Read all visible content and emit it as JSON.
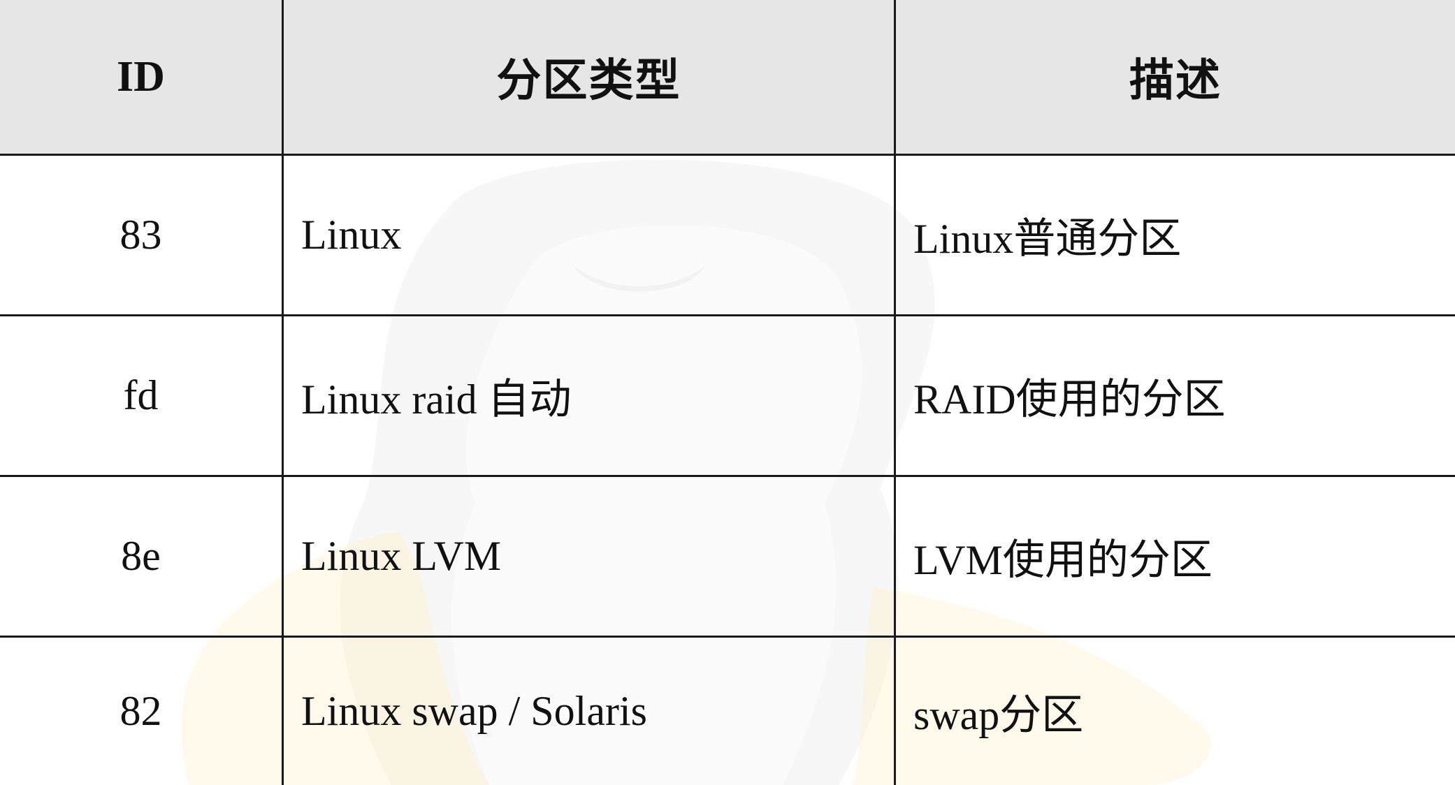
{
  "table": {
    "headers": [
      "ID",
      "分区类型",
      "描述"
    ],
    "rows": [
      {
        "id": "83",
        "type": "Linux",
        "description": "Linux普通分区"
      },
      {
        "id": "fd",
        "type": "Linux raid 自动",
        "description": "RAID使用的分区"
      },
      {
        "id": "8e",
        "type": "Linux LVM",
        "description": "LVM使用的分区"
      },
      {
        "id": "82",
        "type": "Linux swap / Solaris",
        "description": "swap分区"
      }
    ]
  },
  "watermark": {
    "icon": "tux-penguin-icon",
    "colors": {
      "body": "#cfcfcf",
      "feet": "#ffe9a8",
      "shade": "#e8e8e8"
    }
  }
}
